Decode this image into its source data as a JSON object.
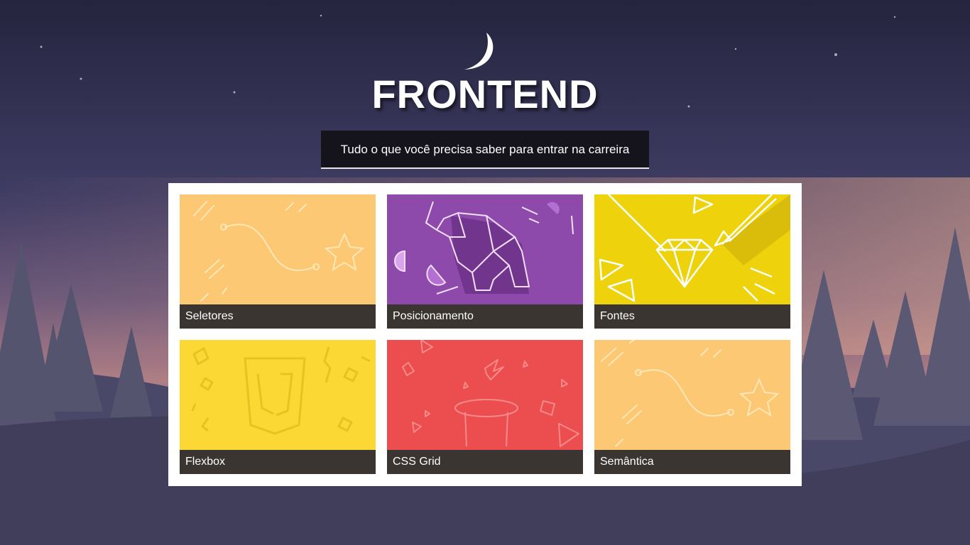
{
  "header": {
    "title": "FRONTEND",
    "tagline": "Tudo o que você precisa saber para entrar na carreira"
  },
  "cards": [
    {
      "label": "Seletores",
      "color": "#fdc873",
      "icon": "star-path-icon"
    },
    {
      "label": "Posicionamento",
      "color": "#8e4aab",
      "icon": "origami-elephant-icon"
    },
    {
      "label": "Fontes",
      "color": "#edd20c",
      "icon": "diamond-pencil-icon"
    },
    {
      "label": "Flexbox",
      "color": "#fbd834",
      "icon": "js-shield-icon"
    },
    {
      "label": "CSS Grid",
      "color": "#ec4e50",
      "icon": "magic-hat-icon"
    },
    {
      "label": "Semântica",
      "color": "#fdc873",
      "icon": "star-path-icon"
    }
  ]
}
